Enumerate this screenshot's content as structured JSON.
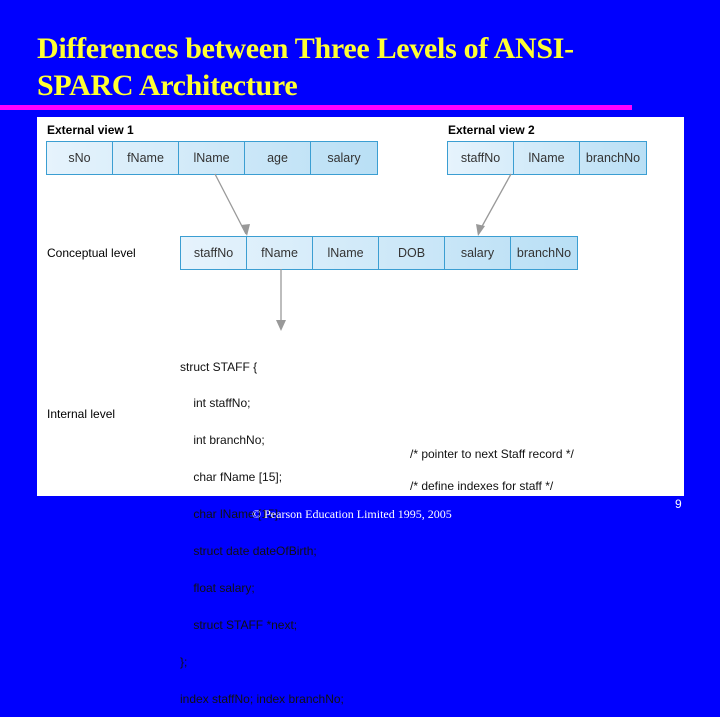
{
  "slide": {
    "title": "Differences between Three Levels of ANSI-SPARC Architecture",
    "title_line1": "Differences between Three Levels of ANSI-",
    "title_line2": "SPARC Architecture",
    "footer": "© Pearson Education Limited 1995, 2005",
    "page_number": "9",
    "colors": {
      "background": "#0000fe",
      "title": "#ffff33",
      "rule": "#ff00ff",
      "cell_border": "#3b9ed2"
    }
  },
  "diagram": {
    "external_view_1": {
      "label": "External view 1",
      "fields": [
        "sNo",
        "fName",
        "lName",
        "age",
        "salary"
      ]
    },
    "external_view_2": {
      "label": "External view 2",
      "fields": [
        "staffNo",
        "lName",
        "branchNo"
      ]
    },
    "conceptual_level": {
      "label": "Conceptual level",
      "fields": [
        "staffNo",
        "fName",
        "lName",
        "DOB",
        "salary",
        "branchNo"
      ]
    },
    "internal_level": {
      "label": "Internal level",
      "code_lines": [
        "struct STAFF {",
        "    int staffNo;",
        "    int branchNo;",
        "    char fName [15];",
        "    char lName [15];",
        "    struct date dateOfBirth;",
        "    float salary;",
        "    struct STAFF *next;",
        "};",
        "index staffNo; index branchNo;"
      ],
      "comments": {
        "next": "/* pointer to next Staff record */",
        "index": "/* define indexes for staff */"
      }
    }
  }
}
